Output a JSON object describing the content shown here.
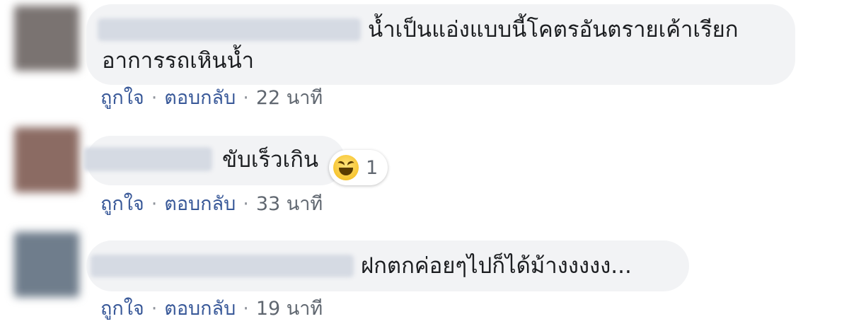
{
  "comments": [
    {
      "text_line1": "น้ำเป็นแอ่งแบบนี้โคตรอันตรายเค้าเรียก",
      "text_line2": "อาการรถเหินน้ำ",
      "like_label": "ถูกใจ",
      "reply_label": "ตอบกลับ",
      "time": "22 นาที",
      "avatar_color": "#7a7371"
    },
    {
      "text_line1": "ขับเร็วเกิน",
      "like_label": "ถูกใจ",
      "reply_label": "ตอบกลับ",
      "time": "33 นาที",
      "avatar_color": "#8b6b63",
      "reaction": {
        "icon": "haha-icon",
        "count": "1"
      }
    },
    {
      "text_line1": "ฝกตกค่อยๆไปก็ได้ม้างงงงง...",
      "like_label": "ถูกใจ",
      "reply_label": "ตอบกลับ",
      "time": "19 นาที",
      "avatar_color": "#6f7d8c"
    }
  ],
  "separator": "·"
}
